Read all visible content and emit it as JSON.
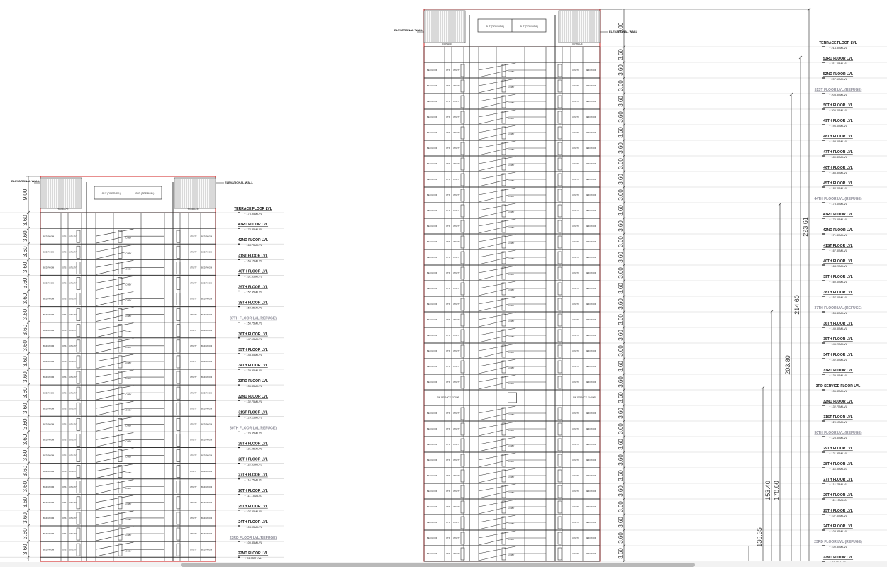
{
  "colors": {
    "outline": "#d21f1f",
    "line": "#333333",
    "gridline": "#cfcfcf",
    "dimension": "#444444",
    "refuge": "#8a8a96"
  },
  "common": {
    "elevational_wall": "ELEVATIONAL WALL",
    "lobby": "LOBBY",
    "utility": "UTILITY",
    "ots": "OTS",
    "bedroom": "BED ROOM",
    "terrace": "TERRACE",
    "oht": "OHT (FIRE/DOM.)"
  },
  "tower_a": {
    "height_dim": "9.00",
    "dim_top_label": "3.60",
    "levels": [
      {
        "name": "TERRACE FLOOR LVL",
        "elev": "+ 175.95M LVL",
        "refuge": false
      },
      {
        "name": "43RD FLOOR LVL",
        "elev": "+ 172.35M LVL",
        "refuge": false
      },
      {
        "name": "42ND FLOOR LVL",
        "elev": "+ 168.75M LVL",
        "refuge": false
      },
      {
        "name": "41ST FLOOR LVL",
        "elev": "+ 165.15M LVL",
        "refuge": false
      },
      {
        "name": "40TH FLOOR LVL",
        "elev": "+ 161.55M LVL",
        "refuge": false
      },
      {
        "name": "39TH FLOOR LVL",
        "elev": "+ 157.95M LVL",
        "refuge": false
      },
      {
        "name": "38TH FLOOR LVL",
        "elev": "+ 154.35M LVL",
        "refuge": false
      },
      {
        "name": "37TH FLOOR LVL(REFUGE)",
        "elev": "+ 150.75M LVL",
        "refuge": true
      },
      {
        "name": "36TH FLOOR LVL",
        "elev": "+ 147.15M LVL",
        "refuge": false
      },
      {
        "name": "35TH FLOOR LVL",
        "elev": "+ 143.55M LVL",
        "refuge": false
      },
      {
        "name": "34TH FLOOR LVL",
        "elev": "+ 139.95M LVL",
        "refuge": false
      },
      {
        "name": "33RD FLOOR LVL",
        "elev": "+ 136.35M LVL",
        "refuge": false
      },
      {
        "name": "32ND FLOOR LVL",
        "elev": "+ 132.75M LVL",
        "refuge": false
      },
      {
        "name": "31ST FLOOR LVL",
        "elev": "+ 129.15M LVL",
        "refuge": false
      },
      {
        "name": "30TH FLOOR LVL(REFUGE)",
        "elev": "+ 125.55M LVL",
        "refuge": true
      },
      {
        "name": "29TH FLOOR LVL",
        "elev": "+ 121.95M LVL",
        "refuge": false
      },
      {
        "name": "28TH FLOOR LVL",
        "elev": "+ 118.35M LVL",
        "refuge": false
      },
      {
        "name": "27TH FLOOR LVL",
        "elev": "+ 114.75M LVL",
        "refuge": false
      },
      {
        "name": "26TH FLOOR LVL",
        "elev": "+ 111.15M LVL",
        "refuge": false
      },
      {
        "name": "25TH FLOOR LVL",
        "elev": "+ 107.55M LVL",
        "refuge": false
      },
      {
        "name": "24TH FLOOR LVL",
        "elev": "+ 103.95M LVL",
        "refuge": false
      },
      {
        "name": "23RD FLOOR LVL(REFUGE)",
        "elev": "+ 100.35M LVL",
        "refuge": true
      },
      {
        "name": "22ND FLOOR LVL",
        "elev": "+ 96.75M LVL",
        "refuge": false
      }
    ]
  },
  "tower_b": {
    "height_dim": "9.00",
    "dim_top_label": "3.60",
    "service_left": "SW SERVICE FLOOR",
    "service_right": "SW SERVICE FLOOR",
    "levels": [
      {
        "name": "TERRACE FLOOR LVL",
        "elev": "+ 214.80M LVL",
        "refuge": false
      },
      {
        "name": "53RD FLOOR LVL",
        "elev": "+ 211.20M LVL",
        "refuge": false
      },
      {
        "name": "52ND FLOOR LVL",
        "elev": "+ 207.60M LVL",
        "refuge": false
      },
      {
        "name": "51ST FLOOR LVL (REFUGE)",
        "elev": "+ 203.80M LVL",
        "refuge": true
      },
      {
        "name": "50TH FLOOR LVL",
        "elev": "+ 200.20M LVL",
        "refuge": false
      },
      {
        "name": "49TH FLOOR LVL",
        "elev": "+ 196.60M LVL",
        "refuge": false
      },
      {
        "name": "48TH FLOOR LVL",
        "elev": "+ 193.00M LVL",
        "refuge": false
      },
      {
        "name": "47TH FLOOR LVL",
        "elev": "+ 189.40M LVL",
        "refuge": false
      },
      {
        "name": "46TH FLOOR LVL",
        "elev": "+ 185.80M LVL",
        "refuge": false
      },
      {
        "name": "45TH FLOOR LVL",
        "elev": "+ 182.20M LVL",
        "refuge": false
      },
      {
        "name": "44TH FLOOR LVL (REFUGE)",
        "elev": "+ 178.60M LVL",
        "refuge": true
      },
      {
        "name": "43RD FLOOR LVL",
        "elev": "+ 175.00M LVL",
        "refuge": false
      },
      {
        "name": "42ND FLOOR LVL",
        "elev": "+ 171.40M LVL",
        "refuge": false
      },
      {
        "name": "41ST FLOOR LVL",
        "elev": "+ 167.80M LVL",
        "refuge": false
      },
      {
        "name": "40TH FLOOR LVL",
        "elev": "+ 164.20M LVL",
        "refuge": false
      },
      {
        "name": "39TH FLOOR LVL",
        "elev": "+ 160.60M LVL",
        "refuge": false
      },
      {
        "name": "38TH FLOOR LVL",
        "elev": "+ 157.00M LVL",
        "refuge": false
      },
      {
        "name": "37TH FLOOR LVL (REFUGE)",
        "elev": "+ 153.40M LVL",
        "refuge": true
      },
      {
        "name": "36TH FLOOR LVL",
        "elev": "+ 149.80M LVL",
        "refuge": false
      },
      {
        "name": "35TH FLOOR LVL",
        "elev": "+ 146.20M LVL",
        "refuge": false
      },
      {
        "name": "34TH FLOOR LVL",
        "elev": "+ 142.60M LVL",
        "refuge": false
      },
      {
        "name": "33RD FLOOR LVL",
        "elev": "+ 139.00M LVL",
        "refuge": false
      },
      {
        "name": "3RD SERVICE FLOOR LVL",
        "elev": "+ 136.35M LVL",
        "refuge": false
      },
      {
        "name": "32ND FLOOR LVL",
        "elev": "+ 132.75M LVL",
        "refuge": false
      },
      {
        "name": "31ST FLOOR LVL",
        "elev": "+ 129.15M LVL",
        "refuge": false
      },
      {
        "name": "30TH FLOOR LVL (REFUGE)",
        "elev": "+ 125.55M LVL",
        "refuge": true
      },
      {
        "name": "29TH FLOOR LVL",
        "elev": "+ 121.95M LVL",
        "refuge": false
      },
      {
        "name": "28TH FLOOR LVL",
        "elev": "+ 118.35M LVL",
        "refuge": false
      },
      {
        "name": "27TH FLOOR LVL",
        "elev": "+ 114.75M LVL",
        "refuge": false
      },
      {
        "name": "26TH FLOOR LVL",
        "elev": "+ 111.15M LVL",
        "refuge": false
      },
      {
        "name": "25TH FLOOR LVL",
        "elev": "+ 107.55M LVL",
        "refuge": false
      },
      {
        "name": "24TH FLOOR LVL",
        "elev": "+ 103.95M LVL",
        "refuge": false
      },
      {
        "name": "23RD FLOOR LVL (REFUGE)",
        "elev": "+ 100.35M LVL",
        "refuge": true
      },
      {
        "name": "22ND FLOOR LVL",
        "elev": "+ 96.75M LVL",
        "refuge": false
      }
    ],
    "height_dimensions": [
      {
        "label": "223.61"
      },
      {
        "label": "214.60"
      },
      {
        "label": "203.80"
      },
      {
        "label": "178.60"
      },
      {
        "label": "153.40"
      },
      {
        "label": "136.35"
      }
    ]
  }
}
